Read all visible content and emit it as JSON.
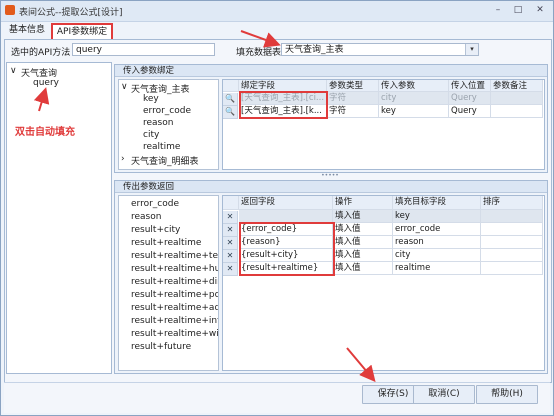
{
  "window": {
    "title": "表间公式--提取公式[设计]",
    "min": "–",
    "max": "□",
    "close": "✕"
  },
  "tabs": [
    {
      "label": "基本信息"
    },
    {
      "label": "API参数绑定"
    }
  ],
  "top": {
    "api_label": "选中的API方法",
    "api_value": "query",
    "fill_label": "填充数据表",
    "fill_value": "天气查询_主表",
    "fill_arrow": "▾"
  },
  "left_tree": {
    "root": "天气查询",
    "child": "query",
    "expand": "∨"
  },
  "annotation": "双击自动填充",
  "in_group": {
    "title": "传入参数绑定",
    "tree": {
      "root": "天气查询_主表",
      "children": [
        "key",
        "error_code",
        "reason",
        "city",
        "realtime"
      ],
      "collapsed": "天气查询_明细表",
      "exp_open": "∨",
      "exp_closed": "›"
    },
    "headers": [
      "绑定字段",
      "参数类型",
      "传入参数",
      "传入位置",
      "参数备注"
    ],
    "rows": [
      {
        "field": "[天气查询_主表].[ci...",
        "type": "字符",
        "param": "city",
        "pos": "Query",
        "note": ""
      },
      {
        "field": "[天气查询_主表].[k...",
        "type": "字符",
        "param": "key",
        "pos": "Query",
        "note": ""
      }
    ]
  },
  "splitter": "•••••",
  "out_group": {
    "title": "传出参数返回",
    "list": [
      "error_code",
      "reason",
      "result+city",
      "result+realtime",
      "result+realtime+tem...",
      "result+realtime+hu...",
      "result+realtime+dire...",
      "result+realtime+po...",
      "result+realtime+aqi",
      "result+realtime+info",
      "result+realtime+wid",
      "result+future"
    ],
    "headers": [
      "返回字段",
      "操作",
      "填充目标字段",
      "排序"
    ],
    "rows": [
      {
        "field": "",
        "op": "填入值",
        "target": "key",
        "sort": ""
      },
      {
        "field": "{error_code}",
        "op": "填入值",
        "target": "error_code",
        "sort": ""
      },
      {
        "field": "{reason}",
        "op": "填入值",
        "target": "reason",
        "sort": ""
      },
      {
        "field": "{result+city}",
        "op": "填入值",
        "target": "city",
        "sort": ""
      },
      {
        "field": "{result+realtime}",
        "op": "填入值",
        "target": "realtime",
        "sort": ""
      }
    ]
  },
  "buttons": {
    "save": "保存(S)",
    "cancel": "取消(C)",
    "help": "帮助(H)"
  },
  "icons": {
    "search": "🔍",
    "delete": "✕"
  },
  "colors": {
    "annotation": "#e03b3b",
    "border": "#a6bad4"
  }
}
